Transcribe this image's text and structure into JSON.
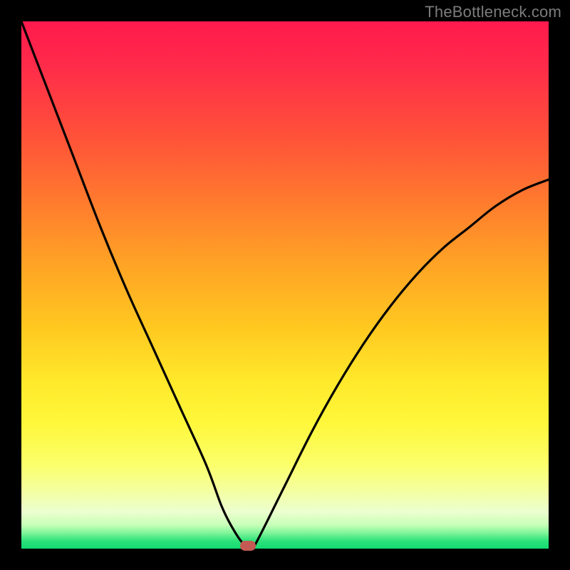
{
  "watermark": "TheBottleneck.com",
  "colors": {
    "background_frame": "#000000",
    "curve_stroke": "#000000",
    "marker_fill": "#c45a53",
    "watermark_text": "#7c7c7c"
  },
  "chart_data": {
    "type": "line",
    "title": "",
    "xlabel": "",
    "ylabel": "",
    "xlim": [
      0,
      100
    ],
    "ylim": [
      0,
      100
    ],
    "grid": false,
    "series": [
      {
        "name": "bottleneck-curve",
        "x": [
          0,
          5,
          10,
          15,
          20,
          25,
          30,
          35,
          38,
          40,
          42,
          43,
          44,
          45,
          50,
          55,
          60,
          65,
          70,
          75,
          80,
          85,
          90,
          95,
          100
        ],
        "y": [
          100,
          87,
          74,
          61,
          49,
          38,
          27,
          16,
          8,
          4,
          1,
          0.5,
          0.5,
          2,
          12,
          22,
          31,
          39,
          46,
          52,
          57,
          61,
          65,
          68,
          70
        ]
      }
    ],
    "marker": {
      "x": 43,
      "y": 0.5
    },
    "gradient_stops": [
      {
        "pos": 0,
        "color": "#ff1a4d"
      },
      {
        "pos": 0.22,
        "color": "#ff5239"
      },
      {
        "pos": 0.46,
        "color": "#ffa325"
      },
      {
        "pos": 0.68,
        "color": "#ffe82a"
      },
      {
        "pos": 0.89,
        "color": "#f4ffa0"
      },
      {
        "pos": 0.97,
        "color": "#80f59a"
      },
      {
        "pos": 1.0,
        "color": "#13da72"
      }
    ]
  }
}
